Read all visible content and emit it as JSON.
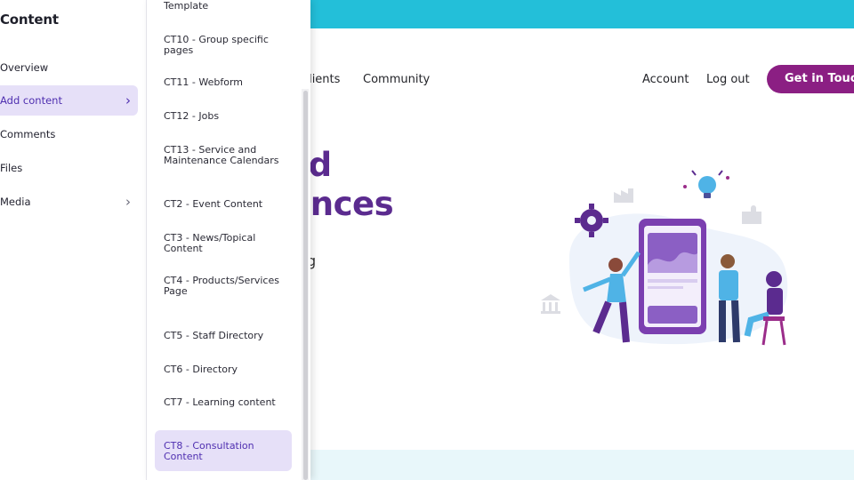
{
  "drawer": {
    "title": "Content",
    "items": [
      {
        "label": "Overview",
        "active": false,
        "has_children": false
      },
      {
        "label": "Add content",
        "active": true,
        "has_children": true
      },
      {
        "label": "Comments",
        "active": false,
        "has_children": false
      },
      {
        "label": "Files",
        "active": false,
        "has_children": false
      },
      {
        "label": "Media",
        "active": false,
        "has_children": true
      }
    ],
    "chevron_glyph": "›"
  },
  "submenu": {
    "items": [
      {
        "label": "Template",
        "active": false
      },
      {
        "label": "CT10 - Group specific pages",
        "active": false
      },
      {
        "label": "CT11 - Webform",
        "active": false
      },
      {
        "label": "CT12 - Jobs",
        "active": false
      },
      {
        "label": "CT13 - Service and Maintenance Calendars",
        "active": false
      },
      {
        "label": "CT2 - Event Content",
        "active": false
      },
      {
        "label": "CT3 - News/Topical Content",
        "active": false
      },
      {
        "label": "CT4 - Products/Services Page",
        "active": false
      },
      {
        "label": "CT5 - Staff Directory",
        "active": false
      },
      {
        "label": "CT6 - Directory",
        "active": false
      },
      {
        "label": "CT7 - Learning content",
        "active": false
      },
      {
        "label": "CT8 - Consultation Content",
        "active": true
      }
    ]
  },
  "site": {
    "nav": {
      "clients": "Clients",
      "community": "Community",
      "account": "Account",
      "logout": "Log out",
      "cta": "Get in Touch"
    },
    "hero": {
      "line1": "ed",
      "line2": "iences",
      "fragment": "g"
    }
  },
  "colors": {
    "topbar": "#23bfd9",
    "accent_purple": "#5b2b8f",
    "cta": "#8b1f83",
    "active_bg": "#e6e0f8",
    "active_text": "#4f2fb0"
  },
  "icons": [
    "chevron-right-icon",
    "gear-icon",
    "lightbulb-icon",
    "puzzle-icon",
    "bank-icon",
    "factory-icon",
    "phone-illustration"
  ]
}
